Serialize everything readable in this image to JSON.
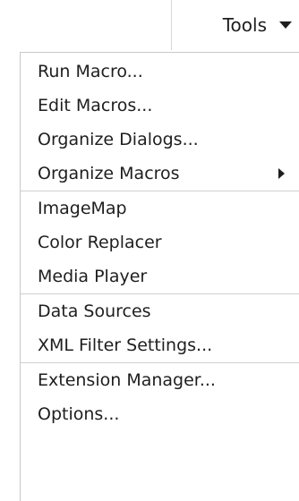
{
  "menubar": {
    "tools_label": "Tools"
  },
  "menu": {
    "groups": [
      {
        "items": [
          {
            "label": "Run Macro..."
          },
          {
            "label": "Edit Macros..."
          },
          {
            "label": "Organize Dialogs..."
          },
          {
            "label": "Organize Macros",
            "has_submenu": true
          }
        ]
      },
      {
        "items": [
          {
            "label": "ImageMap"
          },
          {
            "label": "Color Replacer"
          },
          {
            "label": "Media Player"
          }
        ]
      },
      {
        "items": [
          {
            "label": "Data Sources"
          },
          {
            "label": "XML Filter Settings..."
          }
        ]
      },
      {
        "items": [
          {
            "label": "Extension Manager..."
          },
          {
            "label": "Options..."
          }
        ]
      }
    ]
  },
  "icons": {
    "tools_dropdown": "triangle-down-icon",
    "submenu": "triangle-right-icon"
  }
}
